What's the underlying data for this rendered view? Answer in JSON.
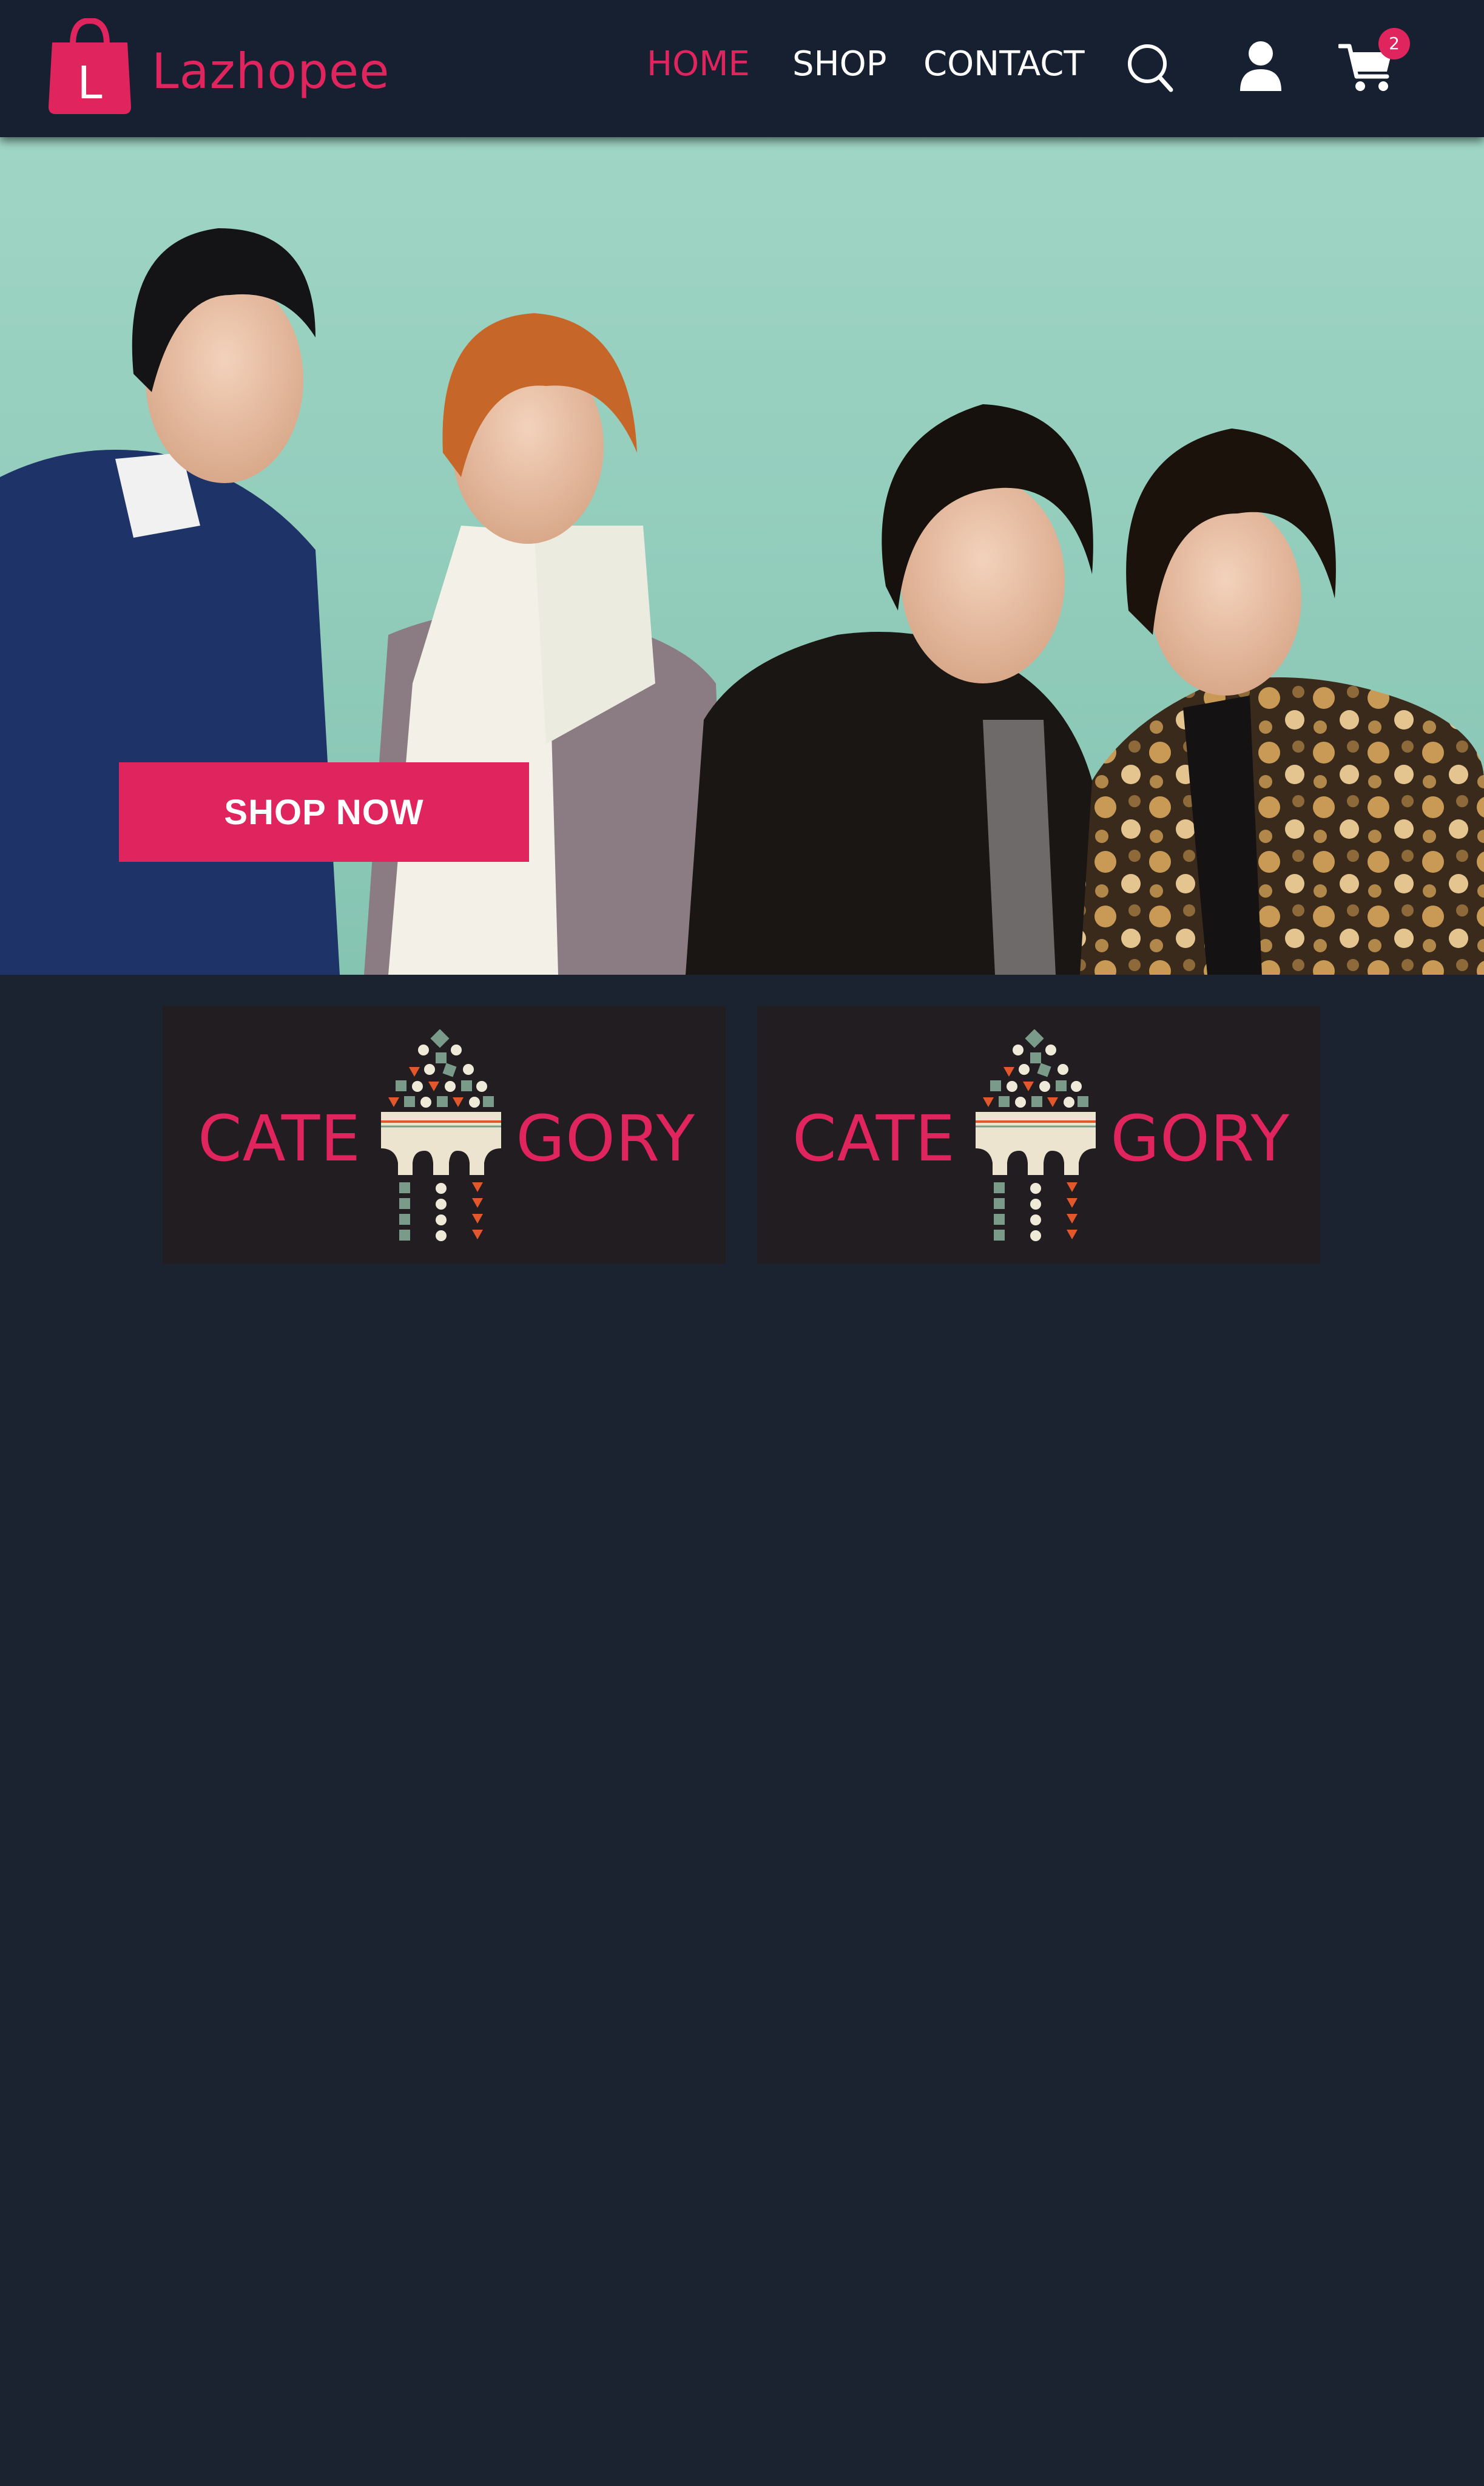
{
  "brand": {
    "logo_letter": "L",
    "name": "Lazhopee",
    "accent_color": "#e0245e"
  },
  "nav": {
    "links": [
      {
        "label": "HOME",
        "active": true
      },
      {
        "label": "SHOP",
        "active": false
      },
      {
        "label": "CONTACT",
        "active": false
      }
    ],
    "icons": [
      "search-icon",
      "user-icon",
      "cart-icon"
    ],
    "cart_count": "2"
  },
  "hero": {
    "image": "photo-of-four-men-posing-against-mint-background",
    "cta_label": "SHOP NOW"
  },
  "categories": [
    {
      "left_text": "CATE",
      "right_text": "GORY",
      "emblem": "mosaic-tree-emblem"
    },
    {
      "left_text": "CATE",
      "right_text": "GORY",
      "emblem": "mosaic-tree-emblem"
    }
  ],
  "colors": {
    "page_background": "#1b2331",
    "header_background": "#172030",
    "card_background": "#221d20"
  }
}
